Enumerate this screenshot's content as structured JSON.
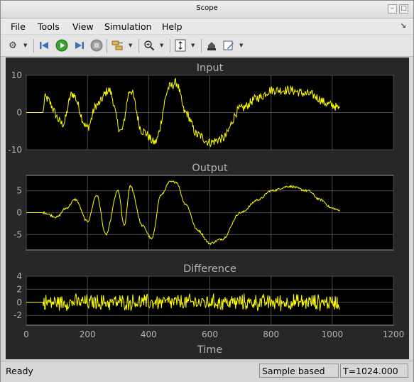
{
  "window": {
    "title": "Scope"
  },
  "menu": [
    "File",
    "Tools",
    "View",
    "Simulation",
    "Help"
  ],
  "toolbar": {
    "icons": [
      "gear-icon",
      "step-back-icon",
      "run-icon",
      "step-forward-icon",
      "stop-icon",
      "signal-select-icon",
      "zoom-in-icon",
      "autoscale-icon",
      "highlight-icon",
      "edit-icon"
    ]
  },
  "status": {
    "state": "Ready",
    "mode": "Sample based",
    "time": "T=1024.000"
  },
  "colors": {
    "trace": "#ffff00",
    "axes_bg": "#000000",
    "figure_bg": "#272727",
    "axis_text": "#b3b3b3"
  },
  "chart_data": [
    {
      "type": "line",
      "title": "Input",
      "xlim": [
        0,
        1200
      ],
      "ylim": [
        -10,
        10
      ],
      "yticks": [
        -10,
        0,
        10
      ],
      "xticks": [
        0,
        200,
        400,
        600,
        800,
        1000,
        1200
      ],
      "grid": true,
      "series": [
        {
          "x": [
            0,
            55,
            60,
            120,
            150,
            200,
            230,
            270,
            310,
            340,
            380,
            420,
            470,
            490,
            520,
            560,
            600,
            640,
            700,
            760,
            800,
            860,
            920,
            1000,
            1024
          ],
          "y": [
            0,
            0,
            4,
            -3,
            5,
            -4,
            2,
            6,
            -5,
            6,
            -5,
            -8,
            7,
            8,
            0,
            -6,
            -8,
            -7,
            1,
            4,
            6,
            6,
            5,
            2,
            1
          ]
        }
      ]
    },
    {
      "type": "line",
      "title": "Output",
      "xlim": [
        0,
        1200
      ],
      "ylim": [
        -8.5,
        8.5
      ],
      "yticks": [
        -5,
        0,
        5
      ],
      "xticks": [
        0,
        200,
        400,
        600,
        800,
        1000,
        1200
      ],
      "grid": true,
      "series": [
        {
          "x": [
            0,
            55,
            100,
            130,
            160,
            200,
            230,
            260,
            300,
            320,
            340,
            380,
            410,
            440,
            470,
            490,
            520,
            560,
            600,
            640,
            700,
            760,
            800,
            860,
            920,
            960,
            1000,
            1024
          ],
          "y": [
            0,
            0,
            -1,
            1,
            3,
            -2,
            4,
            -5,
            5,
            -3,
            6,
            -3,
            -6,
            4,
            7,
            7,
            2,
            -4,
            -7,
            -6,
            0,
            3,
            5,
            6,
            5,
            3,
            1,
            0.5
          ]
        }
      ]
    },
    {
      "type": "line",
      "title": "Difference",
      "xlabel": "Time",
      "xlim": [
        0,
        1200
      ],
      "ylim": [
        -3.5,
        4
      ],
      "yticks": [
        -2,
        0,
        2,
        4
      ],
      "xticks": [
        0,
        200,
        400,
        600,
        800,
        1000,
        1200
      ],
      "grid": true,
      "series": [
        {
          "x": [
            0,
            55,
            1024
          ],
          "y": [
            0,
            0,
            0
          ],
          "noise_amplitude": 1.5
        }
      ]
    }
  ]
}
